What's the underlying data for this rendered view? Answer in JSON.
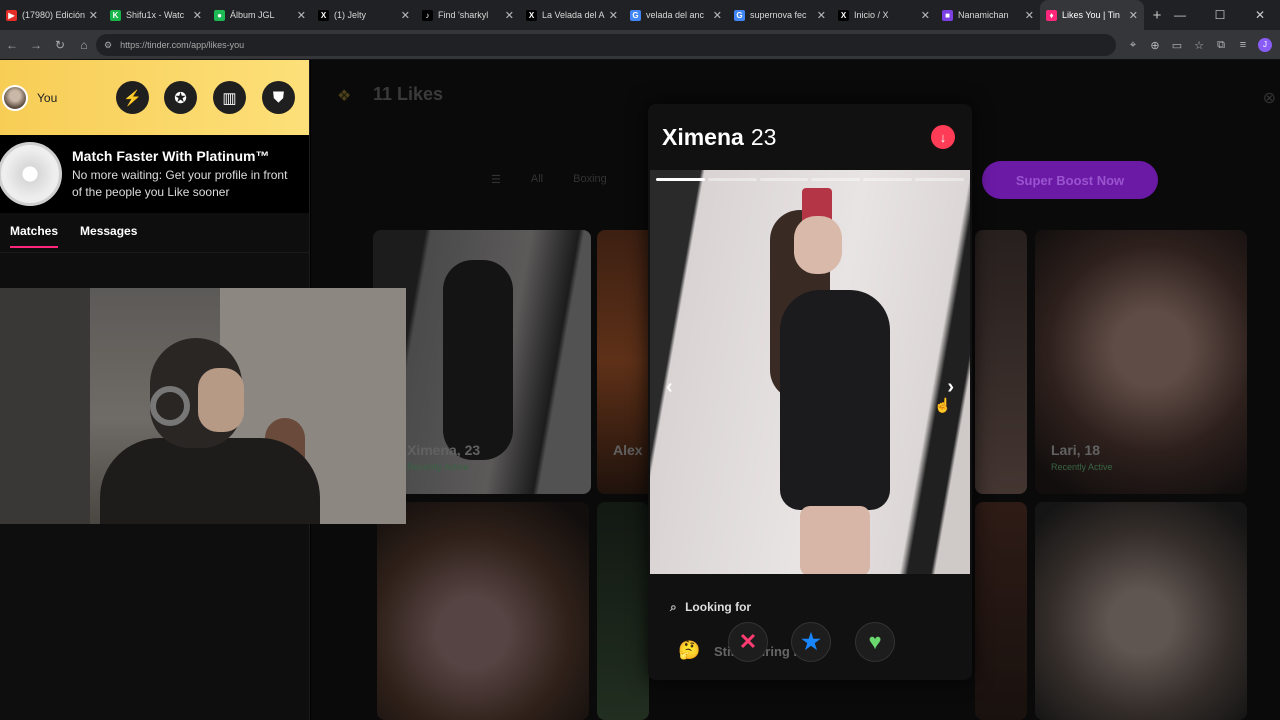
{
  "browser": {
    "tabs": [
      {
        "title": "(17980) Edición",
        "color": "#e52d27",
        "glyph": "▶"
      },
      {
        "title": "Shifu1x - Watc",
        "color": "#18b54a",
        "glyph": "K"
      },
      {
        "title": "Álbum JGL",
        "color": "#1db954",
        "glyph": "●"
      },
      {
        "title": "(1) Jelty",
        "color": "#000000",
        "glyph": "X"
      },
      {
        "title": "Find 'sharkyl",
        "color": "#000000",
        "glyph": "♪"
      },
      {
        "title": "La Velada del A",
        "color": "#000000",
        "glyph": "X"
      },
      {
        "title": "velada del anc",
        "color": "#4285f4",
        "glyph": "G"
      },
      {
        "title": "supernova fec",
        "color": "#4285f4",
        "glyph": "G"
      },
      {
        "title": "Inicio / X",
        "color": "#000000",
        "glyph": "X"
      },
      {
        "title": "Nanamichan",
        "color": "#7b3fe4",
        "glyph": "■"
      },
      {
        "title": "Likes You | Tin",
        "color": "#fd267a",
        "glyph": "♦"
      }
    ],
    "new_tab": "+",
    "url": "https://tinder.com/app/likes-you",
    "close_glyph": "✕"
  },
  "sidebar": {
    "user_label": "You",
    "promo_title": "Match Faster With Platinum™",
    "promo_subtitle": "No more waiting: Get your profile in front of the people you Like sooner",
    "tab_matches": "Matches",
    "tab_messages": "Messages"
  },
  "main": {
    "likes_title": "11 Likes",
    "filters": [
      "All",
      "Boxing"
    ],
    "boost_label": "Super Boost Now",
    "cards": [
      {
        "name": "Ximena, 23",
        "status": "Recently Active"
      },
      {
        "name": "Alex",
        "status": ""
      },
      {
        "name": "Lari, 18",
        "status": "Recently Active"
      }
    ]
  },
  "profile": {
    "name": "Ximena",
    "age": "23",
    "looking_label": "Looking for",
    "looking_value": "Still figuring it out",
    "looking_emoji": "🤔"
  },
  "colors": {
    "accent": "#fd267a",
    "nope": "#fe3c72",
    "superlike": "#1786ff",
    "like": "#6ad76f",
    "platinum_gold": "#f7cd55"
  }
}
